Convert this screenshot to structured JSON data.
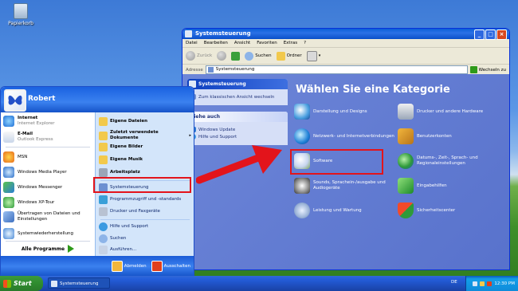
{
  "desktop": {
    "recycle_bin": "Papierkorb"
  },
  "window": {
    "title": "Systemsteuerung",
    "menu": [
      "Datei",
      "Bearbeiten",
      "Ansicht",
      "Favoriten",
      "Extras",
      "?"
    ],
    "toolbar": {
      "back": "Zurück",
      "search": "Suchen",
      "folders": "Ordner"
    },
    "address_label": "Adresse",
    "address_value": "Systemsteuerung",
    "go_label": "Wechseln zu",
    "task_pane": {
      "panel_title": "Systemsteuerung",
      "classic_link": "Zum klassischen Ansicht wechseln",
      "see_also_title": "Siehe auch",
      "see_also": [
        "Windows Update",
        "Hilfe und Support"
      ]
    },
    "heading": "Wählen Sie eine Kategorie",
    "categories": [
      "Darstellung und Designs",
      "Drucker und andere Hardware",
      "Netzwerk- und Internetverbindungen",
      "Benutzerkonten",
      "Software",
      "Datums-, Zeit-, Sprach- und Regionaleinstellungen",
      "Sounds, Sprachein-/ausgabe und Audiogeräte",
      "Eingabehilfen",
      "Leistung und Wartung",
      "Sicherheitscenter"
    ]
  },
  "start_menu": {
    "user": "Robert",
    "pinned": [
      {
        "title": "Internet",
        "sub": "Internet Explorer"
      },
      {
        "title": "E-Mail",
        "sub": "Outlook Express"
      }
    ],
    "recent": [
      "MSN",
      "Windows Media Player",
      "Windows Messenger",
      "Windows XP-Tour",
      "Übertragen von Dateien und Einstellungen",
      "Systemwiederherstellung"
    ],
    "all_programs": "Alle Programme",
    "right": [
      "Eigene Dateien",
      "Zuletzt verwendete Dokumente",
      "Eigene Bilder",
      "Eigene Musik",
      "Arbeitsplatz",
      "Systemsteuerung",
      "Programmzugriff und -standards",
      "Drucker und Faxgeräte",
      "Hilfe und Support",
      "Suchen",
      "Ausführen..."
    ],
    "logoff": "Abmelden",
    "shutdown": "Ausschalten"
  },
  "taskbar": {
    "start": "Start",
    "task": "Systemsteuerung",
    "language": "DE",
    "clock": "12:30 PM"
  },
  "colors": {
    "highlight": "#e3141b",
    "taskbar": "#245edb",
    "start_button": "#2f8c2f"
  }
}
